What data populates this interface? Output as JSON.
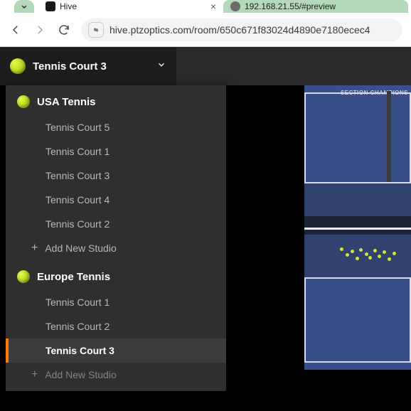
{
  "browser": {
    "tabs": [
      {
        "title": "Hive"
      },
      {
        "title": "192.168.21.55/#preview"
      }
    ],
    "url": "hive.ptzoptics.com/room/650c671f83024d4890e7180ecec4"
  },
  "selector": {
    "current": "Tennis Court 3"
  },
  "groups": [
    {
      "name": "USA Tennis",
      "items": [
        {
          "label": "Tennis Court 5",
          "selected": false
        },
        {
          "label": "Tennis Court 1",
          "selected": false
        },
        {
          "label": "Tennis Court 3",
          "selected": false
        },
        {
          "label": "Tennis Court 4",
          "selected": false
        },
        {
          "label": "Tennis Court 2",
          "selected": false
        }
      ],
      "add_label": "Add New Studio"
    },
    {
      "name": "Europe Tennis",
      "items": [
        {
          "label": "Tennis Court 1",
          "selected": false
        },
        {
          "label": "Tennis Court 2",
          "selected": false
        },
        {
          "label": "Tennis Court 3",
          "selected": true
        }
      ],
      "add_label": "Add New Studio"
    }
  ],
  "preview": {
    "banner": "SECTION CHAMPIONS"
  }
}
